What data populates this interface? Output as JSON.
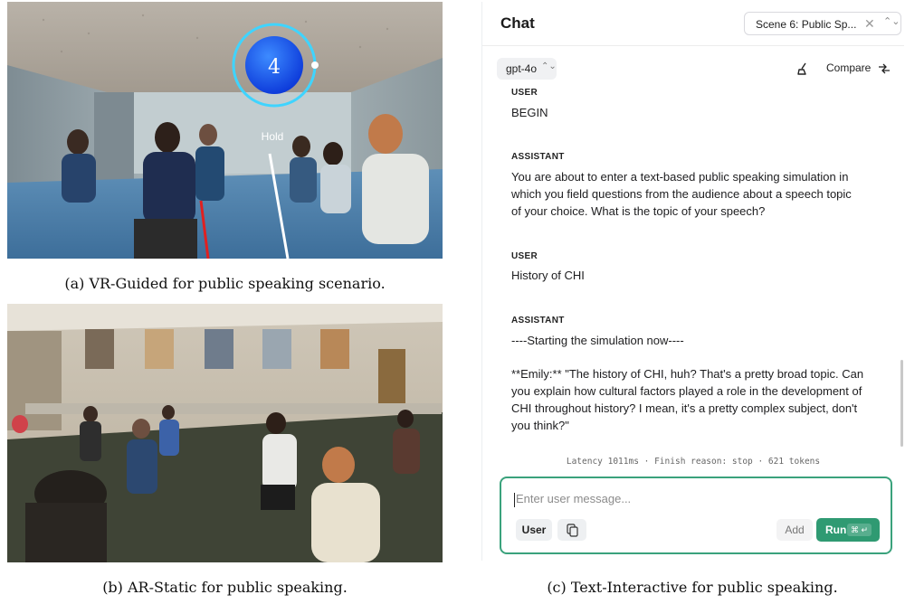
{
  "captions": {
    "a": "(a) VR-Guided for public speaking scenario.",
    "b": "(b) AR-Static for public speaking.",
    "c": "(c) Text-Interactive for public speaking."
  },
  "vr": {
    "counter": "4",
    "hold_label": "Hold"
  },
  "chat": {
    "title": "Chat",
    "scene_select": {
      "value": "Scene 6: Public Sp...",
      "clear": "✕",
      "updown": "⌃⌄"
    },
    "model": {
      "value": "gpt-4o",
      "updown": "⌃⌄"
    },
    "compare_label": "Compare",
    "messages": [
      {
        "role": "USER",
        "text": "BEGIN"
      },
      {
        "role": "ASSISTANT",
        "text": "You are about to enter a text-based public speaking simulation in which you field questions from the audience about a speech topic of your choice. What is the topic of your speech?"
      },
      {
        "role": "USER",
        "text": "History of CHI"
      },
      {
        "role": "ASSISTANT",
        "text": "----Starting the simulation now----",
        "text2": "**Emily:** \"The history of CHI, huh? That's a pretty broad topic. Can you explain how cultural factors played a role in the development of CHI throughout history? I mean, it's a pretty complex subject, don't you think?\""
      }
    ],
    "meta": "Latency 1011ms · Finish reason: stop · 621 tokens",
    "composer": {
      "placeholder": "Enter user message...",
      "user_button": "User",
      "add_button": "Add",
      "run_button": "Run",
      "run_shortcut": "⌘ ↵"
    }
  },
  "colors": {
    "accent": "#2f9a72",
    "composer_border": "#3aa27c"
  }
}
